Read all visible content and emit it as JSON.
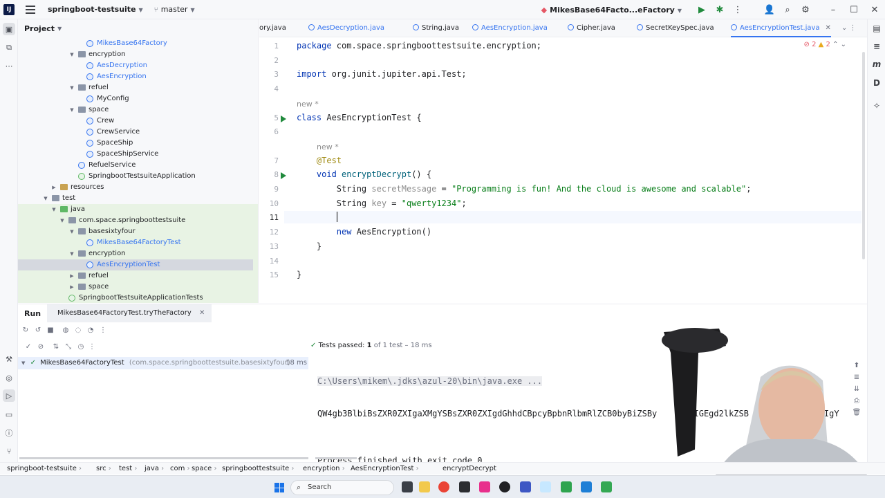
{
  "titlebar": {
    "logo_text": "IJ",
    "project": "springboot-testsuite",
    "branch": "master",
    "run_config": "MikesBase64Facto...eFactory"
  },
  "sidebar": {
    "project_label": "Project"
  },
  "tree": [
    {
      "label": "MikesBase64Factory",
      "type": "class",
      "color": "blue",
      "indent": 125,
      "arrow": ""
    },
    {
      "label": "encryption",
      "type": "folder",
      "indent": 113,
      "arrow": "v"
    },
    {
      "label": "AesDecryption",
      "type": "class",
      "color": "blue",
      "indent": 125,
      "arrow": ""
    },
    {
      "label": "AesEncryption",
      "type": "class",
      "color": "blue",
      "indent": 125,
      "arrow": ""
    },
    {
      "label": "refuel",
      "type": "folder",
      "indent": 113,
      "arrow": "v"
    },
    {
      "label": "MyConfig",
      "type": "class",
      "indent": 125,
      "arrow": ""
    },
    {
      "label": "space",
      "type": "folder",
      "indent": 113,
      "arrow": "v"
    },
    {
      "label": "Crew",
      "type": "class",
      "indent": 125,
      "arrow": ""
    },
    {
      "label": "CrewService",
      "type": "class",
      "indent": 125,
      "arrow": ""
    },
    {
      "label": "SpaceShip",
      "type": "class",
      "indent": 125,
      "arrow": ""
    },
    {
      "label": "SpaceShipService",
      "type": "class",
      "indent": 125,
      "arrow": ""
    },
    {
      "label": "RefuelService",
      "type": "class",
      "indent": 113,
      "arrow": ""
    },
    {
      "label": "SpringbootTestsuiteApplication",
      "type": "spring",
      "indent": 113,
      "arrow": ""
    },
    {
      "label": "resources",
      "type": "res",
      "indent": 87,
      "arrow": ">"
    },
    {
      "label": "test",
      "type": "folder",
      "indent": 75,
      "arrow": "v"
    },
    {
      "label": "java",
      "type": "test",
      "indent": 87,
      "arrow": "v"
    },
    {
      "label": "com.space.springboottestsuite",
      "type": "folder",
      "indent": 99,
      "arrow": "v"
    },
    {
      "label": "basesixtyfour",
      "type": "folder",
      "indent": 113,
      "arrow": "v"
    },
    {
      "label": "MikesBase64FactoryTest",
      "type": "class",
      "color": "blue",
      "indent": 125,
      "arrow": ""
    },
    {
      "label": "encryption",
      "type": "folder",
      "indent": 113,
      "arrow": "v"
    },
    {
      "label": "AesEncryptionTest",
      "type": "class",
      "color": "blue",
      "indent": 125,
      "arrow": "",
      "selected": true
    },
    {
      "label": "refuel",
      "type": "folder",
      "indent": 113,
      "arrow": ">"
    },
    {
      "label": "space",
      "type": "folder",
      "indent": 113,
      "arrow": ">"
    },
    {
      "label": "SpringbootTestsuiteApplicationTests",
      "type": "spring",
      "indent": 99,
      "arrow": ""
    }
  ],
  "tabs": [
    {
      "label": "ory.java",
      "blue": false
    },
    {
      "label": "AesDecryption.java",
      "blue": true
    },
    {
      "label": "String.java",
      "blue": false
    },
    {
      "label": "AesEncryption.java",
      "blue": true
    },
    {
      "label": "Cipher.java",
      "blue": false
    },
    {
      "label": "SecretKeySpec.java",
      "blue": false
    },
    {
      "label": "AesEncryptionTest.java",
      "blue": true,
      "active": true
    }
  ],
  "editor": {
    "problems": "2 2",
    "current_line": 11,
    "lines": [
      {
        "n": "1",
        "parts": [
          [
            "kw",
            "package "
          ],
          [
            "",
            "com.space.springboottestsuite.encryption;"
          ]
        ]
      },
      {
        "n": "2",
        "parts": []
      },
      {
        "n": "3",
        "parts": [
          [
            "kw",
            "import "
          ],
          [
            "",
            "org.junit.jupiter.api.Test;"
          ]
        ]
      },
      {
        "n": "4",
        "parts": []
      },
      {
        "hint": "new *"
      },
      {
        "n": "5",
        "run": true,
        "parts": [
          [
            "kw",
            "class "
          ],
          [
            "",
            "AesEncryptionTest {"
          ]
        ]
      },
      {
        "n": "6",
        "parts": []
      },
      {
        "hint": "new *",
        "indent": 1
      },
      {
        "n": "7",
        "parts": [
          [
            "ann",
            "    @Test"
          ]
        ]
      },
      {
        "n": "8",
        "run": true,
        "parts": [
          [
            "kw",
            "    void "
          ],
          [
            "fn",
            "encryptDecrypt"
          ],
          [
            "",
            "() {"
          ]
        ]
      },
      {
        "n": "9",
        "parts": [
          [
            "",
            "        String "
          ],
          [
            "gray",
            "secretMessage"
          ],
          [
            "",
            " = "
          ],
          [
            "str",
            "\"Programming is fun! And the cloud is awesome and scalable\""
          ],
          [
            "",
            ";"
          ]
        ]
      },
      {
        "n": "10",
        "parts": [
          [
            "",
            "        String "
          ],
          [
            "gray",
            "key"
          ],
          [
            "",
            " = "
          ],
          [
            "str",
            "\"qwerty1234\""
          ],
          [
            "",
            ";"
          ]
        ]
      },
      {
        "n": "11",
        "parts": []
      },
      {
        "n": "12",
        "parts": [
          [
            "kw",
            "        new "
          ],
          [
            "",
            "AesEncryption()"
          ]
        ]
      },
      {
        "n": "13",
        "parts": [
          [
            "",
            "    }"
          ]
        ]
      },
      {
        "n": "14",
        "parts": []
      },
      {
        "n": "15",
        "parts": [
          [
            "",
            "}"
          ]
        ]
      }
    ]
  },
  "run": {
    "title": "Run",
    "config_tab": "MikesBase64FactoryTest.tryTheFactory",
    "tests_passed_label": "Tests passed:",
    "tests_passed_count": "1",
    "tests_passed_rest": "of 1 test – 18 ms",
    "test_name": "MikesBase64FactoryTest",
    "test_pkg": "(com.space.springboottestsuite.basesixtyfour)",
    "test_time": "18 ms",
    "console_cmd": "C:\\Users\\mikem\\.jdks\\azul-20\\bin\\java.exe ...",
    "console_out": "QW4gb3BlbiBsZXR0ZXIgaXMgYSBsZXR0ZXIgdGhhdCBpcyBpbnRlbmRlZCB0byBiZSBy",
    "console_out_tail": "5IGEgd2lkZSB",
    "console_out_end": "wgb3IgY",
    "console_exit": "Process finished with exit code 0"
  },
  "breadcrumb": [
    "springboot-testsuite",
    "src",
    "test",
    "java",
    "com",
    "space",
    "springboottestsuite",
    "encryption",
    "AesEncryptionTest",
    "encryptDecrypt"
  ],
  "taskbar": {
    "search": "Search"
  },
  "colors": {
    "accent": "#3574f0",
    "run_green": "#208a3c",
    "string": "#067d17",
    "keyword": "#0033b3"
  }
}
